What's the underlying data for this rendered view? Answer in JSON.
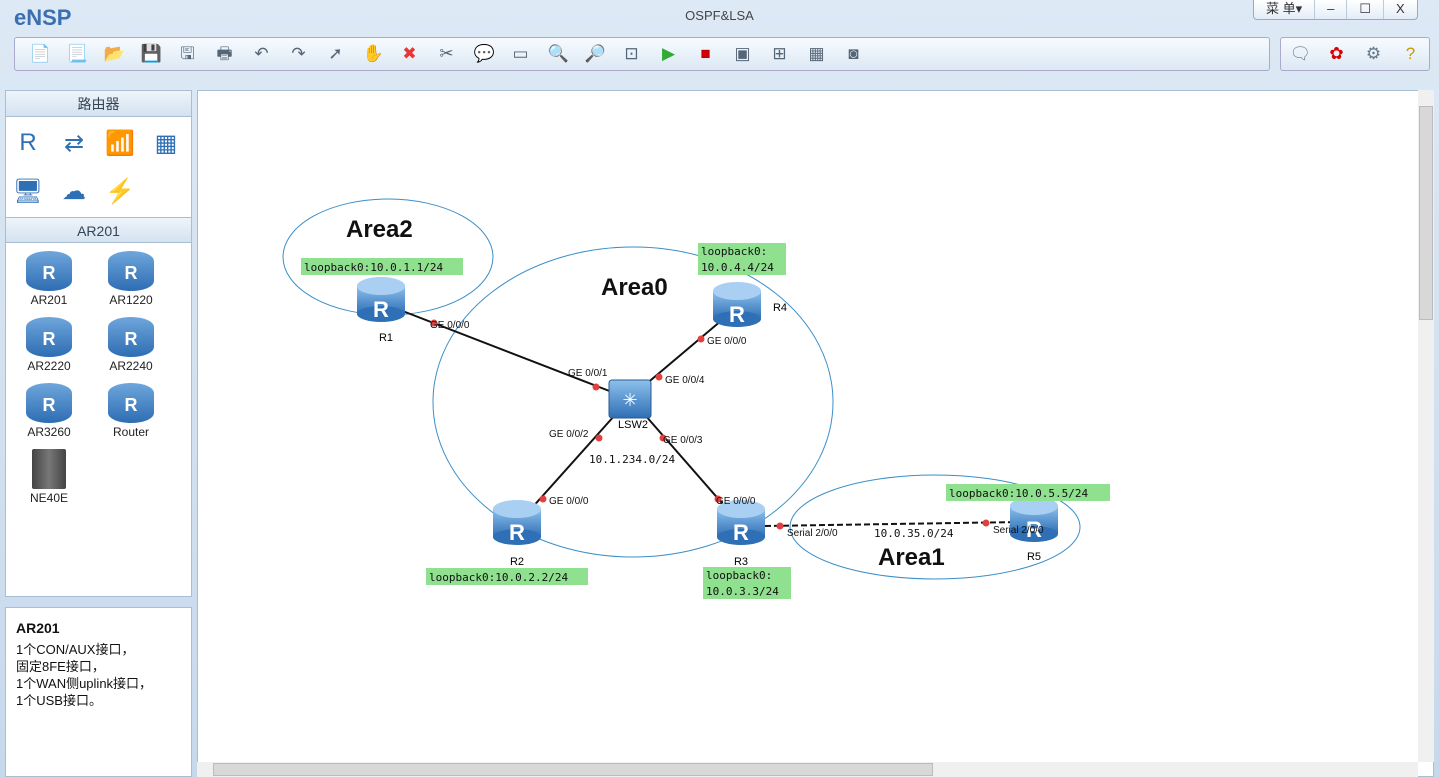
{
  "app": {
    "name": "eNSP",
    "title": "OSPF&LSA",
    "menu": "菜 单▾",
    "minimize": "–",
    "maximize": "☐",
    "close": "X"
  },
  "toolbar": [
    {
      "icon": "new-topology-icon",
      "glyph": "📄"
    },
    {
      "icon": "new-script-icon",
      "glyph": "📃"
    },
    {
      "icon": "open-icon",
      "glyph": "📂"
    },
    {
      "icon": "save-icon",
      "glyph": "💾"
    },
    {
      "icon": "save-as-icon",
      "glyph": "🖫"
    },
    {
      "icon": "print-icon",
      "glyph": "🖶"
    },
    {
      "icon": "undo-icon",
      "glyph": "↶"
    },
    {
      "icon": "redo-icon",
      "glyph": "↷"
    },
    {
      "icon": "select-icon",
      "glyph": "➚"
    },
    {
      "icon": "pan-hand-icon",
      "glyph": "✋"
    },
    {
      "icon": "delete-icon",
      "glyph": "✖"
    },
    {
      "icon": "delete-link-icon",
      "glyph": "✂"
    },
    {
      "icon": "text-note-icon",
      "glyph": "💬"
    },
    {
      "icon": "rectangle-icon",
      "glyph": "▭"
    },
    {
      "icon": "zoom-in-icon",
      "glyph": "🔍"
    },
    {
      "icon": "zoom-out-icon",
      "glyph": "🔎"
    },
    {
      "icon": "fit-icon",
      "glyph": "⊡"
    },
    {
      "icon": "start-icon",
      "glyph": "▶"
    },
    {
      "icon": "stop-icon",
      "glyph": "■"
    },
    {
      "icon": "capture-icon",
      "glyph": "▣"
    },
    {
      "icon": "topology-icon",
      "glyph": "⊞"
    },
    {
      "icon": "grid-icon",
      "glyph": "▦"
    },
    {
      "icon": "screen-icon",
      "glyph": "◙"
    }
  ],
  "toolbar_right": [
    {
      "icon": "forum-icon",
      "glyph": "🗨"
    },
    {
      "icon": "huawei-icon",
      "glyph": "✿"
    },
    {
      "icon": "settings-icon",
      "glyph": "⚙"
    },
    {
      "icon": "help-icon",
      "glyph": "?"
    }
  ],
  "colors": {
    "accent": "#3a6fb0",
    "label_bg": "#8fe08f",
    "port_dot": "#e04040",
    "area_ellipse": "#3a8fc8"
  },
  "sidebar": {
    "category_title": "路由器",
    "categories": [
      {
        "icon": "router-icon",
        "glyph": "R"
      },
      {
        "icon": "switch-icon",
        "glyph": "⇄"
      },
      {
        "icon": "wireless-icon",
        "glyph": "📶"
      },
      {
        "icon": "firewall-icon",
        "glyph": "▦"
      },
      {
        "icon": "pc-icon",
        "glyph": "🖥"
      },
      {
        "icon": "cloud-icon",
        "glyph": "☁"
      },
      {
        "icon": "link-icon",
        "glyph": "⚡"
      }
    ],
    "device_title": "AR201",
    "devices": [
      "AR201",
      "AR1220",
      "AR2220",
      "AR2240",
      "AR3260",
      "Router",
      "NE40E"
    ]
  },
  "description": {
    "title": "AR201",
    "lines": [
      "1个CON/AUX接口，",
      "固定8FE接口，",
      "1个WAN侧uplink接口，",
      "1个USB接口。"
    ]
  },
  "topology": {
    "areas": [
      "Area2",
      "Area0",
      "Area1"
    ],
    "nodes": [
      "R1",
      "R4",
      "LSW2",
      "R2",
      "R3",
      "R5"
    ],
    "loopbacks": {
      "r1": "loopback0:10.0.1.1/24",
      "r4a": "loopback0:",
      "r4b": "10.0.4.4/24",
      "r2": "loopback0:10.0.2.2/24",
      "r3a": "loopback0:",
      "r3b": "10.0.3.3/24",
      "r5": "loopback0:10.0.5.5/24"
    },
    "ports": {
      "r1": "GE 0/0/0",
      "sw1": "GE 0/0/1",
      "r4": "GE 0/0/0",
      "sw4": "GE 0/0/4",
      "sw2": "GE 0/0/2",
      "sw3": "GE 0/0/3",
      "r2": "GE 0/0/0",
      "r3": "GE 0/0/0",
      "r3s": "Serial 2/0/0",
      "r5s": "Serial 2/0/0"
    },
    "networks": {
      "lan": "10.1.234.0/24",
      "serial": "10.0.35.0/24"
    }
  }
}
